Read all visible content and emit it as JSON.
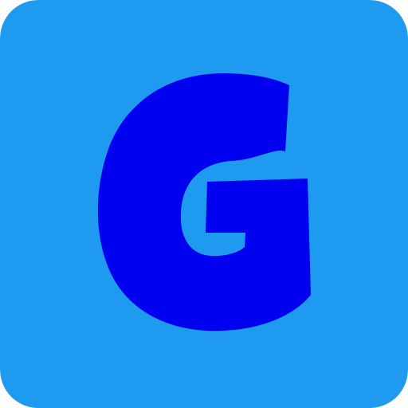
{
  "icon": {
    "name": "letter-g-logo-icon",
    "letter": "G",
    "colors": {
      "background": "#1E9BF0",
      "glyph": "#0000F0"
    }
  }
}
